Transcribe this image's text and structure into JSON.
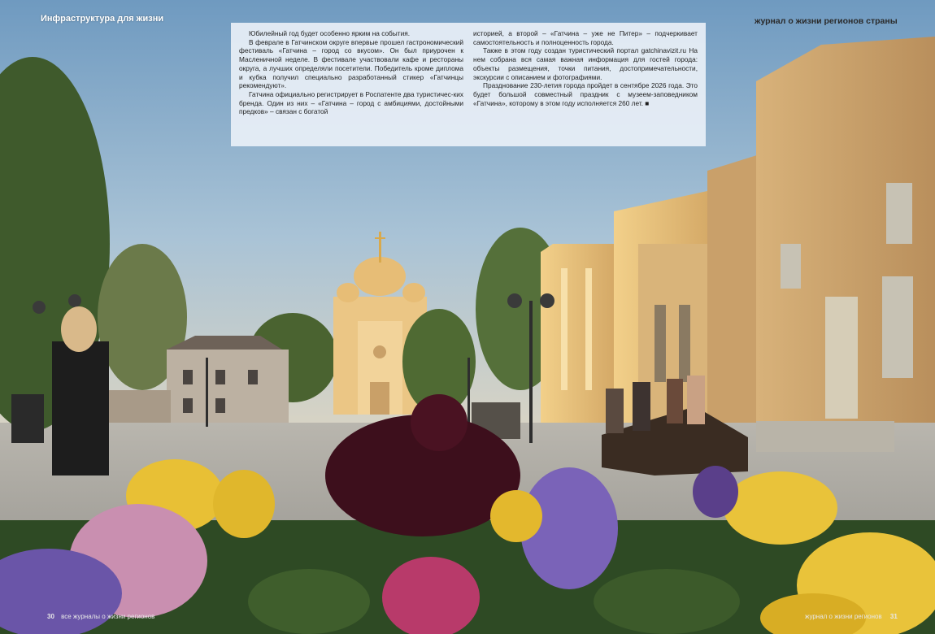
{
  "header": {
    "left_section": "Инфраструктура для жизни",
    "right_magazine": "журнал о жизни регионов страны"
  },
  "article": {
    "col1": [
      "Юбилейный год будет особенно ярким на события.",
      "В феврале в Гатчинском округе впервые прошел гастрономический фестиваль «Гатчина – город со вкусом». Он был приурочен к Масленичной неделе. В фестивале участвовали кафе и рестораны округа, а лучших определяли посетители. Победитель кроме диплома и кубка получил специально разработанный стикер «Гатчинцы рекомендуют».",
      "Гатчина официально регистрирует в Роспатенте два туристичес-ких бренда. Один из них – «Гатчина – город с амбициями, достойными предков» – связан с богатой"
    ],
    "col2": [
      "историей, а второй – «Гатчина – уже не Питер» – подчеркивает самостоятельность и полноценность города.",
      "Также в этом году создан туристический портал gatchinavizit.ru На нем собрана вся самая важная информация для гостей города: объекты размещения, точки питания, достопримечательности, экскурсии с описанием и фотографиями.",
      "Празднование 230-летия города пройдет в сентябре 2026 года. Это будет большой совместный праздник с музеем-заповедником «Гатчина», которому в этом году исполняется 260 лет. ■"
    ]
  },
  "footer": {
    "left_page": "30",
    "left_text": "все журналы о жизни регионов",
    "right_text": "журнал о жизни регионов",
    "right_page": "31"
  },
  "colors": {
    "sky": "#7fa6c6",
    "text_box": "#e8eff6",
    "building_yellow": "#e6c27a",
    "cathedral": "#e9c07e"
  }
}
